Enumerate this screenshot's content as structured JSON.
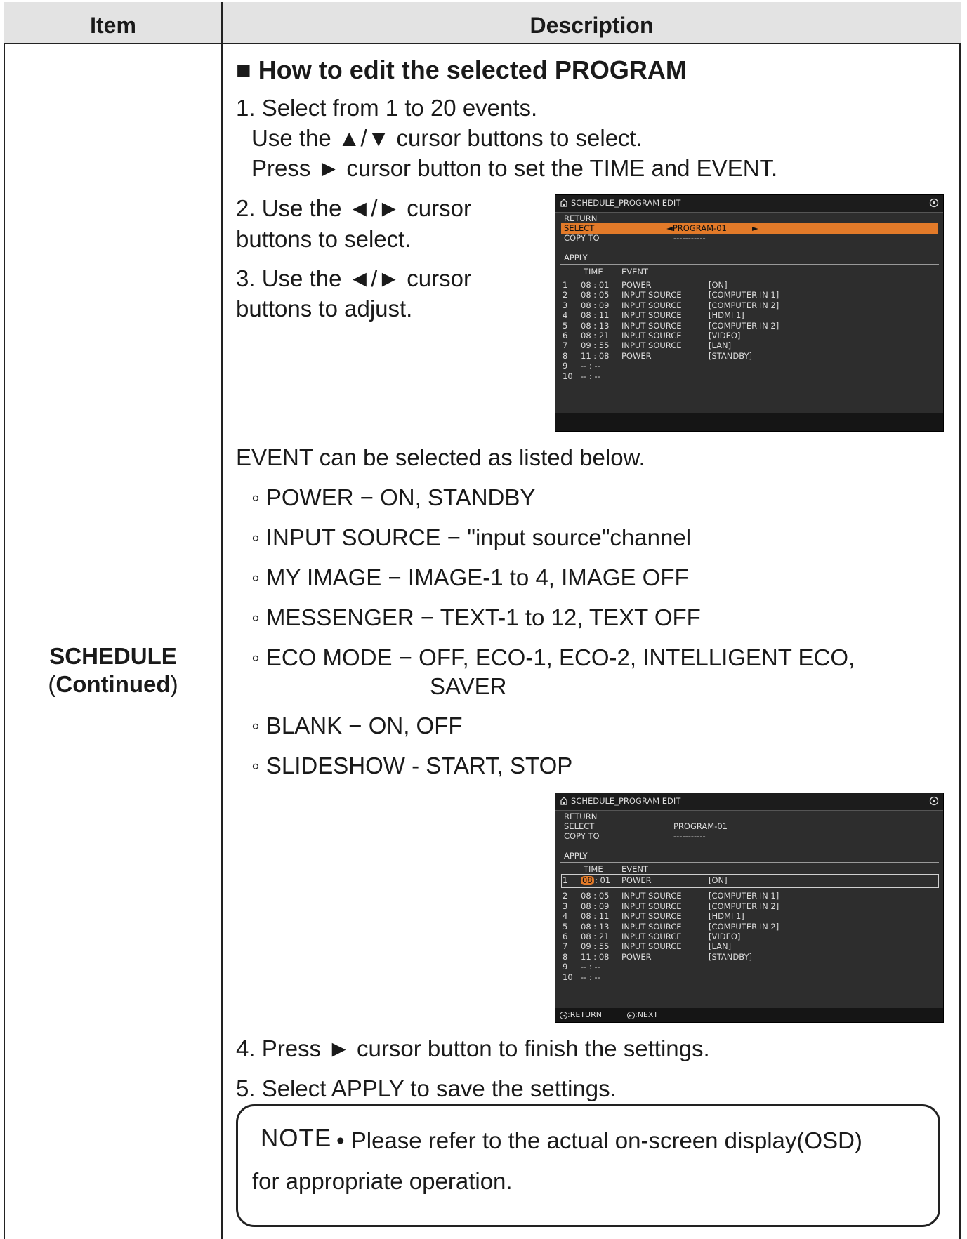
{
  "header": {
    "item": "Item",
    "description": "Description"
  },
  "item": {
    "name": "SCHEDULE",
    "sub_open": "(",
    "sub_word": "Continued",
    "sub_close": ")"
  },
  "section_title": "■ How to edit the selected PROGRAM",
  "step1": {
    "line1": "1. Select from 1 to 20 events.",
    "line2": "Use the ▲/▼ cursor buttons to select.",
    "line3": "Press ► cursor button to set the TIME and EVENT."
  },
  "step2": {
    "line1": "2. Use the ◄/► cursor",
    "line2": "buttons to select."
  },
  "step3": {
    "line1": "3. Use the ◄/► cursor",
    "line2": "buttons to adjust."
  },
  "events_intro": "EVENT can be selected as listed below.",
  "events": [
    "◦ POWER − ON, STANDBY",
    "◦ INPUT SOURCE − \"input source\"channel",
    "◦ MY IMAGE − IMAGE-1 to 4, IMAGE OFF",
    "◦ MESSENGER − TEXT-1 to 12, TEXT OFF",
    "◦ ECO MODE − OFF, ECO-1, ECO-2, INTELLIGENT ECO,",
    "SAVER",
    "◦ BLANK − ON, OFF",
    "◦ SLIDESHOW - START, STOP"
  ],
  "step4": "4. Press ► cursor button to finish the settings.",
  "step5": "5. Select APPLY to save the settings.",
  "note": {
    "label": "NOTE",
    "line1": "• Please refer to the actual on-screen display(OSD)",
    "line2": "for appropriate operation."
  },
  "osd1": {
    "title": "SCHEDULE_PROGRAM EDIT",
    "menu": [
      "RETURN",
      "SELECT",
      "COPY TO",
      "APPLY"
    ],
    "select_value": "◄PROGRAM-01",
    "select_arrow": "►",
    "copy_value": "-----------",
    "col_time": "TIME",
    "col_event": "EVENT",
    "rows": [
      {
        "n": "1",
        "time": "08 : 01",
        "event": "POWER",
        "value": "[ON]"
      },
      {
        "n": "2",
        "time": "08 : 05",
        "event": "INPUT SOURCE",
        "value": "[COMPUTER IN 1]"
      },
      {
        "n": "3",
        "time": "08 : 09",
        "event": "INPUT SOURCE",
        "value": "[COMPUTER IN 2]"
      },
      {
        "n": "4",
        "time": "08 : 11",
        "event": "INPUT SOURCE",
        "value": "[HDMI 1]"
      },
      {
        "n": "5",
        "time": "08 : 13",
        "event": "INPUT SOURCE",
        "value": "[COMPUTER IN 2]"
      },
      {
        "n": "6",
        "time": "08 : 21",
        "event": "INPUT SOURCE",
        "value": "[VIDEO]"
      },
      {
        "n": "7",
        "time": "09 : 55",
        "event": "INPUT SOURCE",
        "value": "[LAN]"
      },
      {
        "n": "8",
        "time": "11 : 08",
        "event": "POWER",
        "value": "[STANDBY]"
      },
      {
        "n": "9",
        "time": "-- : --",
        "event": "",
        "value": ""
      },
      {
        "n": "10",
        "time": "-- : --",
        "event": "",
        "value": ""
      }
    ]
  },
  "osd2": {
    "title": "SCHEDULE_PROGRAM EDIT",
    "menu": [
      "RETURN",
      "SELECT",
      "COPY TO",
      "APPLY"
    ],
    "select_value": "PROGRAM-01",
    "copy_value": "-----------",
    "col_time": "TIME",
    "col_event": "EVENT",
    "row1_hour": "08",
    "row1_rest": ": 01",
    "rows": [
      {
        "n": "1",
        "time": "",
        "event": "POWER",
        "value": "[ON]"
      },
      {
        "n": "2",
        "time": "08 : 05",
        "event": "INPUT SOURCE",
        "value": "[COMPUTER IN 1]"
      },
      {
        "n": "3",
        "time": "08 : 09",
        "event": "INPUT SOURCE",
        "value": "[COMPUTER IN 2]"
      },
      {
        "n": "4",
        "time": "08 : 11",
        "event": "INPUT SOURCE",
        "value": "[HDMI 1]"
      },
      {
        "n": "5",
        "time": "08 : 13",
        "event": "INPUT SOURCE",
        "value": "[COMPUTER IN 2]"
      },
      {
        "n": "6",
        "time": "08 : 21",
        "event": "INPUT SOURCE",
        "value": "[VIDEO]"
      },
      {
        "n": "7",
        "time": "09 : 55",
        "event": "INPUT SOURCE",
        "value": "[LAN]"
      },
      {
        "n": "8",
        "time": "11 : 08",
        "event": "POWER",
        "value": "[STANDBY]"
      },
      {
        "n": "9",
        "time": "-- : --",
        "event": "",
        "value": ""
      },
      {
        "n": "10",
        "time": "-- : --",
        "event": "",
        "value": ""
      }
    ],
    "footer_return": ":RETURN",
    "footer_next": ":NEXT"
  }
}
